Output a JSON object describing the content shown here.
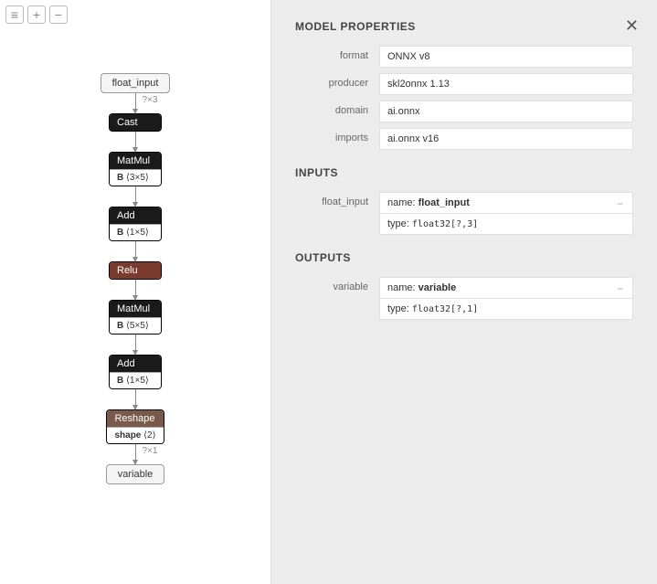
{
  "toolbar": {
    "menu": "≡",
    "zoomIn": "+",
    "zoomOut": "−"
  },
  "graph": {
    "input": {
      "label": "float_input",
      "edge": "?×3"
    },
    "nodes": [
      {
        "op": "Cast",
        "sub": null,
        "cls": ""
      },
      {
        "op": "MatMul",
        "sub": "B ⟨3×5⟩",
        "cls": ""
      },
      {
        "op": "Add",
        "sub": "B ⟨1×5⟩",
        "cls": ""
      },
      {
        "op": "Relu",
        "sub": null,
        "cls": "relu"
      },
      {
        "op": "MatMul",
        "sub": "B ⟨5×5⟩",
        "cls": ""
      },
      {
        "op": "Add",
        "sub": "B ⟨1×5⟩",
        "cls": ""
      },
      {
        "op": "Reshape",
        "sub": "shape ⟨2⟩",
        "cls": "reshape"
      }
    ],
    "output": {
      "label": "variable",
      "edge": "?×1"
    }
  },
  "panel": {
    "title": "MODEL PROPERTIES",
    "props": [
      {
        "k": "format",
        "v": "ONNX v8"
      },
      {
        "k": "producer",
        "v": "skl2onnx 1.13"
      },
      {
        "k": "domain",
        "v": "ai.onnx"
      },
      {
        "k": "imports",
        "v": "ai.onnx v16"
      }
    ],
    "inputsTitle": "INPUTS",
    "inputs": [
      {
        "label": "float_input",
        "name": "float_input",
        "type": "float32[?,3]"
      }
    ],
    "outputsTitle": "OUTPUTS",
    "outputs": [
      {
        "label": "variable",
        "name": "variable",
        "type": "float32[?,1]"
      }
    ],
    "nameLabel": "name: ",
    "typeLabel": "type: "
  }
}
